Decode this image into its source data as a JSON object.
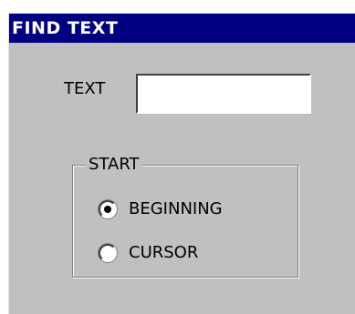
{
  "dialog": {
    "title": "FIND TEXT"
  },
  "text_field": {
    "label": "TEXT",
    "value": "",
    "placeholder": ""
  },
  "start_group": {
    "legend": "START",
    "options": [
      {
        "label": "BEGINNING",
        "selected": true
      },
      {
        "label": "CURSOR",
        "selected": false
      }
    ]
  }
}
